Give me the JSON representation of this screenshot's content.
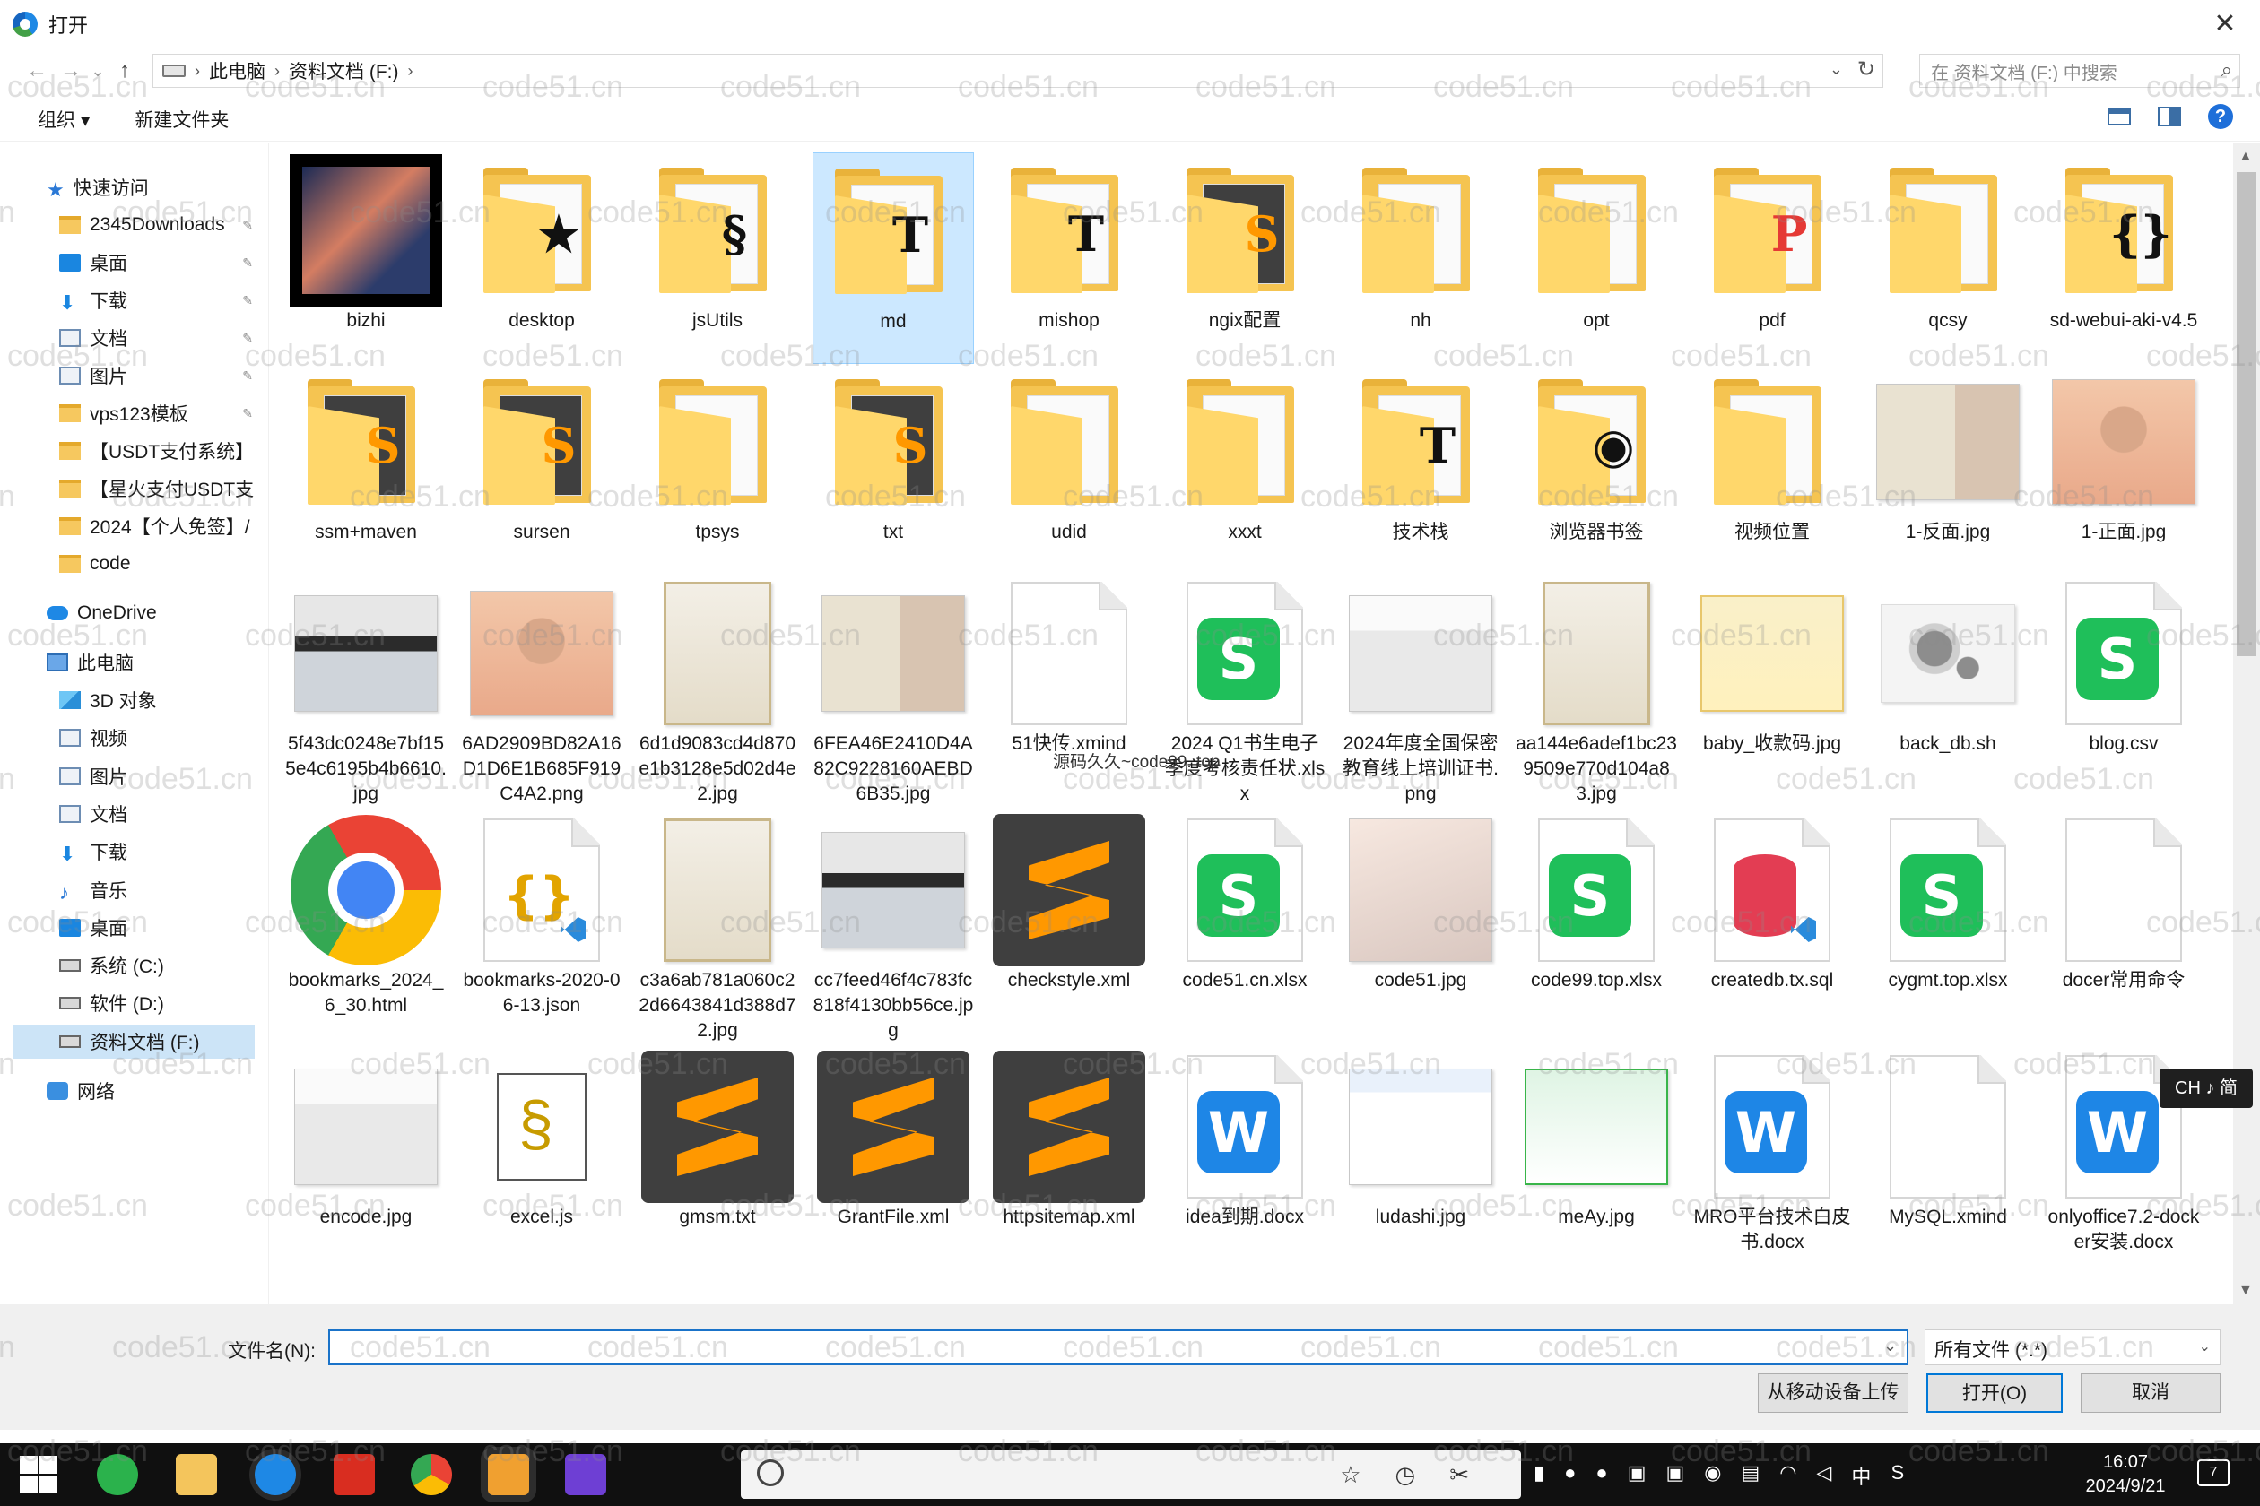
{
  "window": {
    "title": "打开",
    "close_glyph": "✕"
  },
  "nav": {
    "back_glyph": "←",
    "forward_glyph": "→",
    "recent_glyph": "⌄",
    "up_glyph": "↑",
    "breadcrumb": [
      "此电脑",
      "资料文档 (F:)"
    ],
    "crumb_sep": "›",
    "dropdown_glyph": "⌄",
    "refresh_glyph": "↻",
    "search_placeholder": "在 资料文档 (F:) 中搜索",
    "search_glyph": "⌕"
  },
  "toolbar": {
    "organize": "组织 ▾",
    "new_folder": "新建文件夹",
    "help": "?"
  },
  "sidebar": {
    "quick_access": "快速访问",
    "items": [
      {
        "label": "2345Downloads",
        "icon": "folder-icon",
        "pinned": true
      },
      {
        "label": "桌面",
        "icon": "desktop-icon",
        "pinned": true
      },
      {
        "label": "下载",
        "icon": "download-icon",
        "pinned": true
      },
      {
        "label": "文档",
        "icon": "documents-icon",
        "pinned": true
      },
      {
        "label": "图片",
        "icon": "pictures-icon",
        "pinned": true
      },
      {
        "label": "vps123模板",
        "icon": "folder-icon",
        "pinned": true
      },
      {
        "label": "【USDT支付系统】",
        "icon": "folder-icon",
        "pinned": false
      },
      {
        "label": "【星火支付USDT支",
        "icon": "folder-icon",
        "pinned": false
      },
      {
        "label": "2024【个人免签】/",
        "icon": "folder-icon",
        "pinned": false
      },
      {
        "label": "code",
        "icon": "folder-icon",
        "pinned": false
      }
    ],
    "onedrive": "OneDrive",
    "this_pc": "此电脑",
    "pc_items": [
      {
        "label": "3D 对象",
        "icon": "3d-objects-icon"
      },
      {
        "label": "视频",
        "icon": "videos-icon"
      },
      {
        "label": "图片",
        "icon": "pictures-icon"
      },
      {
        "label": "文档",
        "icon": "documents-icon"
      },
      {
        "label": "下载",
        "icon": "download-icon"
      },
      {
        "label": "音乐",
        "icon": "music-icon"
      },
      {
        "label": "桌面",
        "icon": "desktop-icon"
      },
      {
        "label": "系统 (C:)",
        "icon": "drive-icon"
      },
      {
        "label": "软件 (D:)",
        "icon": "drive-icon"
      },
      {
        "label": "资料文档 (F:)",
        "icon": "drive-icon",
        "selected": true
      }
    ],
    "network": "网络",
    "pin_glyph": "📌"
  },
  "files": [
    {
      "name": "bizhi",
      "kind": "bigimg"
    },
    {
      "name": "desktop",
      "kind": "folder",
      "emb": "★"
    },
    {
      "name": "jsUtils",
      "kind": "folder",
      "emb": "§"
    },
    {
      "name": "md",
      "kind": "folder",
      "emb": "T",
      "selected": true
    },
    {
      "name": "mishop",
      "kind": "folder",
      "emb": "T"
    },
    {
      "name": "ngix配置",
      "kind": "folder",
      "emb": "S"
    },
    {
      "name": "nh",
      "kind": "folder",
      "emb": ""
    },
    {
      "name": "opt",
      "kind": "folder",
      "emb": ""
    },
    {
      "name": "pdf",
      "kind": "folder",
      "emb": "P"
    },
    {
      "name": "qcsy",
      "kind": "folder",
      "emb": ""
    },
    {
      "name": "sd-webui-aki-v4.5",
      "kind": "folder",
      "emb": "{}"
    },
    {
      "name": "ssm+maven",
      "kind": "folder",
      "emb": "S"
    },
    {
      "name": "sursen",
      "kind": "folder",
      "emb": "S"
    },
    {
      "name": "tpsys",
      "kind": "folder",
      "emb": ""
    },
    {
      "name": "txt",
      "kind": "folder",
      "emb": "S"
    },
    {
      "name": "udid",
      "kind": "folder",
      "emb": ""
    },
    {
      "name": "xxxt",
      "kind": "folder",
      "emb": ""
    },
    {
      "name": "技术栈",
      "kind": "folder",
      "emb": "T"
    },
    {
      "name": "浏览器书签",
      "kind": "folder",
      "emb": "◉"
    },
    {
      "name": "视频位置",
      "kind": "folder",
      "emb": ""
    },
    {
      "name": "1-反面.jpg",
      "kind": "photo",
      "style": "ph-id"
    },
    {
      "name": "1-正面.jpg",
      "kind": "photo",
      "style": "ph-portrait"
    },
    {
      "name": "5f43dc0248e7bf155e4c6195b4b6610.jpg",
      "kind": "photo",
      "style": "ph-card"
    },
    {
      "name": "6AD2909BD82A16D1D6E1B685F919C4A2.png",
      "kind": "photo",
      "style": "ph-portrait"
    },
    {
      "name": "6d1d9083cd4d870e1b3128e5d02d4e2.jpg",
      "kind": "photo",
      "style": "ph-cert"
    },
    {
      "name": "6FEA46E2410D4A82C9228160AEBD6B35.jpg",
      "kind": "photo",
      "style": "ph-id"
    },
    {
      "name": "51快传.xmind",
      "kind": "page",
      "badge": ""
    },
    {
      "name": "2024 Q1书生电子季度考核责任状.xlsx",
      "kind": "page",
      "badge": "s"
    },
    {
      "name": "2024年度全国保密教育线上培训证书.png",
      "kind": "photo",
      "style": "ph-tax"
    },
    {
      "name": "aa144e6adef1bc239509e770d104a83.jpg",
      "kind": "photo",
      "style": "ph-cert"
    },
    {
      "name": "baby_收款码.jpg",
      "kind": "photo",
      "style": "ph-paylist"
    },
    {
      "name": "back_db.sh",
      "kind": "photo",
      "style": "ph-gear"
    },
    {
      "name": "blog.csv",
      "kind": "page",
      "badge": "s"
    },
    {
      "name": "bookmarks_2024_6_30.html",
      "kind": "chrome"
    },
    {
      "name": "bookmarks-2020-06-13.json",
      "kind": "page",
      "badge": "brace"
    },
    {
      "name": "c3a6ab781a060c22d6643841d388d72.jpg",
      "kind": "photo",
      "style": "ph-cert"
    },
    {
      "name": "cc7feed46f4c783fc818f4130bb56ce.jpg",
      "kind": "photo",
      "style": "ph-card"
    },
    {
      "name": "checkstyle.xml",
      "kind": "sublime"
    },
    {
      "name": "code51.cn.xlsx",
      "kind": "page",
      "badge": "s"
    },
    {
      "name": "code51.jpg",
      "kind": "photo",
      "style": "ph-anime"
    },
    {
      "name": "code99.top.xlsx",
      "kind": "page",
      "badge": "s"
    },
    {
      "name": "createdb.tx.sql",
      "kind": "page",
      "badge": "db"
    },
    {
      "name": "cygmt.top.xlsx",
      "kind": "page",
      "badge": "s"
    },
    {
      "name": "docer常用命令",
      "kind": "page",
      "badge": ""
    },
    {
      "name": "encode.jpg",
      "kind": "photo",
      "style": "ph-tax"
    },
    {
      "name": "excel.js",
      "kind": "script"
    },
    {
      "name": "gmsm.txt",
      "kind": "sublime"
    },
    {
      "name": "GrantFile.xml",
      "kind": "sublime"
    },
    {
      "name": "httpsitemap.xml",
      "kind": "sublime"
    },
    {
      "name": "idea到期.docx",
      "kind": "page",
      "badge": "w"
    },
    {
      "name": "ludashi.jpg",
      "kind": "photo",
      "style": "ph-web"
    },
    {
      "name": "meAy.jpg",
      "kind": "photo",
      "style": "ph-wx"
    },
    {
      "name": "MRO平台技术白皮书.docx",
      "kind": "page",
      "badge": "w"
    },
    {
      "name": "MySQL.xmind",
      "kind": "page",
      "badge": ""
    },
    {
      "name": "onlyoffice7.2-docker安装.docx",
      "kind": "page",
      "badge": "w"
    }
  ],
  "overlay_text": "源码久久~code99. top",
  "watermark": "code51.cn",
  "bottom": {
    "filename_label": "文件名(N):",
    "filename_value": "",
    "filetype": "所有文件 (*.*)",
    "upload_button": "从移动设备上传",
    "open_button": "打开(O)",
    "cancel_button": "取消"
  },
  "ime_indicator": "CH ♪ 简",
  "taskbar": {
    "tray_text": "中",
    "time": "16:07",
    "date": "2024/9/21",
    "notif_count": "7"
  }
}
